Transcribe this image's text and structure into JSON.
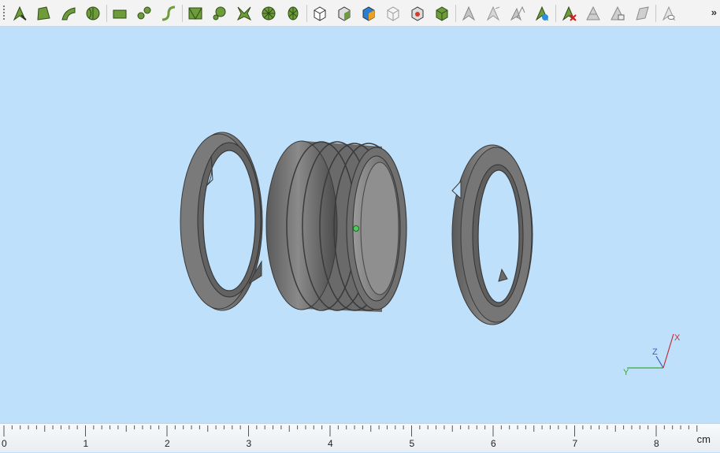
{
  "toolbar": {
    "groups": [
      [
        "select-arrow-icon",
        "face-select-icon",
        "edge-select-icon",
        "shell-select-icon"
      ],
      [
        "plane-select-icon",
        "vertex-select-icon",
        "curve-select-icon"
      ],
      [
        "mesh-face-icon",
        "mesh-node-icon",
        "mesh-spoke-icon",
        "mesh-disc-icon",
        "mesh-fan-icon"
      ],
      [
        "cube-view-icon",
        "cube-shaded-icon",
        "cube-color-icon",
        "cube-wire-icon",
        "cube-red-icon",
        "cube-green-icon"
      ],
      [
        "pointer-grey-icon",
        "pointer-faded-icon",
        "pointer-double-icon",
        "pointer-blue-icon"
      ],
      [
        "pointer-delete-icon",
        "layer-grey-icon",
        "layer-copy-icon",
        "layer-plane-icon"
      ],
      [
        "pointer-eye-icon"
      ]
    ],
    "overflow_label": "»"
  },
  "colors": {
    "toolbar_icon_green": "#6e9c3b",
    "viewport_bg": "#bfe0fb",
    "model_grey": "#6f6f6f",
    "axis_x": "#c0303a",
    "axis_y": "#3aa83a",
    "axis_z": "#3a5cc0"
  },
  "triad": {
    "x_label": "X",
    "y_label": "Y",
    "z_label": "Z"
  },
  "ruler": {
    "labels": [
      "0",
      "1",
      "2",
      "3",
      "4",
      "5",
      "6",
      "7",
      "8"
    ],
    "units": "cm"
  }
}
